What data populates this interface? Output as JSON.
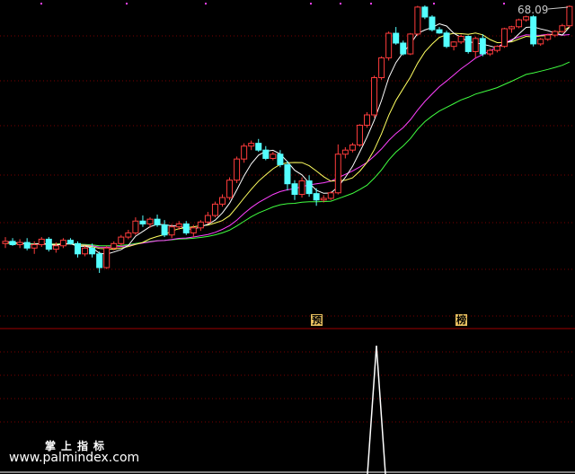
{
  "chart_data": {
    "type": "candlestick",
    "price_label": "68.09",
    "candles": [
      [
        13.0,
        13.6,
        12.6,
        13.2
      ],
      [
        13.2,
        13.5,
        12.8,
        12.9
      ],
      [
        12.9,
        13.4,
        12.6,
        13.1
      ],
      [
        13.1,
        13.5,
        12.4,
        12.6
      ],
      [
        12.6,
        13.2,
        12.1,
        12.9
      ],
      [
        12.9,
        13.6,
        12.7,
        13.4
      ],
      [
        13.4,
        13.6,
        12.3,
        12.5
      ],
      [
        12.5,
        13.1,
        12.2,
        12.8
      ],
      [
        12.8,
        13.5,
        12.6,
        13.3
      ],
      [
        13.3,
        13.5,
        12.9,
        13.0
      ],
      [
        13.0,
        13.2,
        11.8,
        12.1
      ],
      [
        12.1,
        12.8,
        11.9,
        12.6
      ],
      [
        12.6,
        13.0,
        11.8,
        12.1
      ],
      [
        12.1,
        12.3,
        10.6,
        11.0
      ],
      [
        11.0,
        12.8,
        10.9,
        12.6
      ],
      [
        12.6,
        13.2,
        12.4,
        13.0
      ],
      [
        13.0,
        13.8,
        12.8,
        13.6
      ],
      [
        13.6,
        14.3,
        13.4,
        14.0
      ],
      [
        14.0,
        15.6,
        13.8,
        15.2
      ],
      [
        15.2,
        15.8,
        14.6,
        14.9
      ],
      [
        14.9,
        15.6,
        14.5,
        15.4
      ],
      [
        15.4,
        15.9,
        14.6,
        14.8
      ],
      [
        14.8,
        15.3,
        13.6,
        13.8
      ],
      [
        13.8,
        14.9,
        13.5,
        14.6
      ],
      [
        14.6,
        15.2,
        14.3,
        14.9
      ],
      [
        14.9,
        15.2,
        13.8,
        14.0
      ],
      [
        14.0,
        14.8,
        13.6,
        14.5
      ],
      [
        14.5,
        15.3,
        14.2,
        15.1
      ],
      [
        15.1,
        16.2,
        14.9,
        15.8
      ],
      [
        15.8,
        17.4,
        15.6,
        17.1
      ],
      [
        17.1,
        18.3,
        16.8,
        17.9
      ],
      [
        17.9,
        20.6,
        17.6,
        20.2
      ],
      [
        20.2,
        23.8,
        19.8,
        23.4
      ],
      [
        23.4,
        26.1,
        22.8,
        25.6
      ],
      [
        25.6,
        26.6,
        24.9,
        26.1
      ],
      [
        26.1,
        26.9,
        24.6,
        24.9
      ],
      [
        24.9,
        25.6,
        23.2,
        23.5
      ],
      [
        23.5,
        24.6,
        23.2,
        24.2
      ],
      [
        24.2,
        24.9,
        22.1,
        22.5
      ],
      [
        22.5,
        23.1,
        18.8,
        19.7
      ],
      [
        19.7,
        20.2,
        17.6,
        18.3
      ],
      [
        18.3,
        20.6,
        17.9,
        20.1
      ],
      [
        20.1,
        20.9,
        18.0,
        18.4
      ],
      [
        18.4,
        19.1,
        16.9,
        17.6
      ],
      [
        17.6,
        18.2,
        17.3,
        17.8
      ],
      [
        17.8,
        18.7,
        17.6,
        18.5
      ],
      [
        18.5,
        25.9,
        18.3,
        24.2
      ],
      [
        24.2,
        25.4,
        23.5,
        24.9
      ],
      [
        24.9,
        26.2,
        24.5,
        25.8
      ],
      [
        25.8,
        29.8,
        25.5,
        29.6
      ],
      [
        29.6,
        32.4,
        29.1,
        31.8
      ],
      [
        31.8,
        41.8,
        31.2,
        41.2
      ],
      [
        41.2,
        47.8,
        40.6,
        47.3
      ],
      [
        47.3,
        56.8,
        46.4,
        56.1
      ],
      [
        56.1,
        58.6,
        51.8,
        52.4
      ],
      [
        52.4,
        53.3,
        48.1,
        48.6
      ],
      [
        48.6,
        56.2,
        48.2,
        55.8
      ],
      [
        55.8,
        67.9,
        55.1,
        67.3
      ],
      [
        67.3,
        68.1,
        61.9,
        62.8
      ],
      [
        62.8,
        63.6,
        56.8,
        57.5
      ],
      [
        57.5,
        58.6,
        55.9,
        56.2
      ],
      [
        56.2,
        57.1,
        50.6,
        51.2
      ],
      [
        51.2,
        53.1,
        49.8,
        52.8
      ],
      [
        52.8,
        55.6,
        52.1,
        54.9
      ],
      [
        54.9,
        55.3,
        48.7,
        49.4
      ],
      [
        49.4,
        54.8,
        47.2,
        54.1
      ],
      [
        54.1,
        55.7,
        47.8,
        48.6
      ],
      [
        48.6,
        50.4,
        47.9,
        49.8
      ],
      [
        49.8,
        51.6,
        49.1,
        51.2
      ],
      [
        51.2,
        58.3,
        50.7,
        57.9
      ],
      [
        57.9,
        59.1,
        56.3,
        58.7
      ],
      [
        58.7,
        62.1,
        58.1,
        61.6
      ],
      [
        61.6,
        63.4,
        60.8,
        62.9
      ],
      [
        62.9,
        63.7,
        51.2,
        52.1
      ],
      [
        52.1,
        54.3,
        51.4,
        53.8
      ],
      [
        53.8,
        55.9,
        53.2,
        55.4
      ],
      [
        55.4,
        57.3,
        54.6,
        56.8
      ],
      [
        56.8,
        59.9,
        56.3,
        59.1
      ],
      [
        59.1,
        68.1,
        58.2,
        67.6
      ]
    ],
    "indicator_markers": [
      {
        "label": "预",
        "index": 43
      },
      {
        "label": "榜",
        "index": 63
      }
    ],
    "signal_peak_index": 63,
    "colors": {
      "up": "#ff3c3c",
      "down": "#54ffff",
      "ma5": "#ffffff",
      "ma10": "#ffff60",
      "ma20": "#ff40ff",
      "ma60": "#40ff40",
      "grid": "#7a0000",
      "marker": "#e8c060"
    },
    "caption": "掌上指标",
    "url": "www.palmindex.com"
  }
}
